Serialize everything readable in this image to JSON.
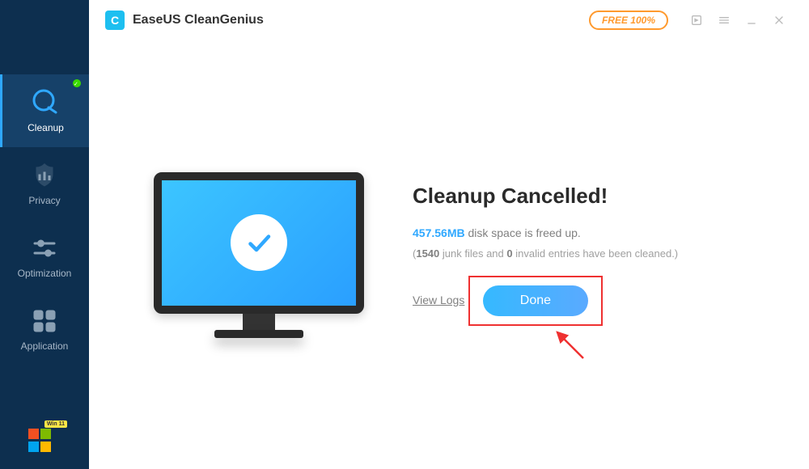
{
  "app": {
    "title": "EaseUS CleanGenius",
    "logo_letter": "C",
    "free_badge": "FREE 100%"
  },
  "sidebar": {
    "items": [
      {
        "label": "Cleanup",
        "icon": "cleanup-icon",
        "active": true
      },
      {
        "label": "Privacy",
        "icon": "privacy-icon",
        "active": false
      },
      {
        "label": "Optimization",
        "icon": "optimization-icon",
        "active": false
      },
      {
        "label": "Application",
        "icon": "application-icon",
        "active": false
      }
    ],
    "win_tag": "Win 11"
  },
  "result": {
    "heading": "Cleanup Cancelled!",
    "freed_size": "457.56MB",
    "freed_text_suffix": " disk space is freed up.",
    "junk_count": "1540",
    "junk_label": " junk files and ",
    "invalid_count": "0",
    "invalid_label": " invalid entries have been cleaned.)",
    "view_logs": "View Logs",
    "done_label": "Done"
  }
}
